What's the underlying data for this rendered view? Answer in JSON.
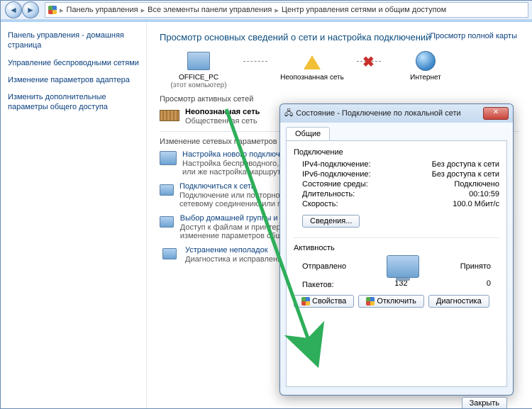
{
  "breadcrumb": {
    "p1": "Панель управления",
    "p2": "Все элементы панели управления",
    "p3": "Центр управления сетями и общим доступом"
  },
  "sidebar": {
    "home": "Панель управления - домашняя страница",
    "links": [
      "Управление беспроводными сетями",
      "Изменение параметров адаптера",
      "Изменить дополнительные параметры общего доступа"
    ]
  },
  "main": {
    "title": "Просмотр основных сведений о сети и настройка подключений",
    "full_map_link": "Просмотр полной карты",
    "nodes": {
      "pc": "OFFICE_PC",
      "pc_sub": "(этот компьютер)",
      "unknown": "Неопознанная сеть",
      "internet": "Интернет"
    },
    "active_label": "Просмотр активных сетей",
    "active": {
      "name": "Неопознанная сеть",
      "type": "Общественная сеть"
    },
    "params_label": "Изменение сетевых параметров",
    "tasks": [
      {
        "title": "Настройка нового подключения",
        "desc": "Настройка беспроводного, широкополосного, модемного, прямого или VPN-подключения или же настройка маршрутизатора или точки доступа."
      },
      {
        "title": "Подключиться к сети",
        "desc": "Подключение или повторное подключение к беспроводному, проводному, модемному сетевому соединению или подключение к VPN."
      },
      {
        "title": "Выбор домашней группы и параметров общего доступа",
        "desc": "Доступ к файлам и принтерам, расположенным на других сетевых компьютерах, или изменение параметров общего доступа."
      },
      {
        "title": "Устранение неполадок",
        "desc": "Диагностика и исправление сетевых проблем или получение сведений об исправлении."
      }
    ]
  },
  "dialog": {
    "title": "Состояние - Подключение по локальной сети",
    "tab": "Общие",
    "conn_group": "Подключение",
    "rows": {
      "ipv4_k": "IPv4-подключение:",
      "ipv4_v": "Без доступа к сети",
      "ipv6_k": "IPv6-подключение:",
      "ipv6_v": "Без доступа к сети",
      "media_k": "Состояние среды:",
      "media_v": "Подключено",
      "dur_k": "Длительность:",
      "dur_v": "00:10:59",
      "spd_k": "Скорость:",
      "spd_v": "100.0 Мбит/с"
    },
    "details_btn": "Сведения...",
    "activity_group": "Активность",
    "sent": "Отправлено",
    "recv": "Принято",
    "packets_label": "Пакетов:",
    "packets_sent": "132",
    "packets_recv": "0",
    "btn_props": "Свойства",
    "btn_disable": "Отключить",
    "btn_diag": "Диагностика",
    "btn_close": "Закрыть"
  }
}
